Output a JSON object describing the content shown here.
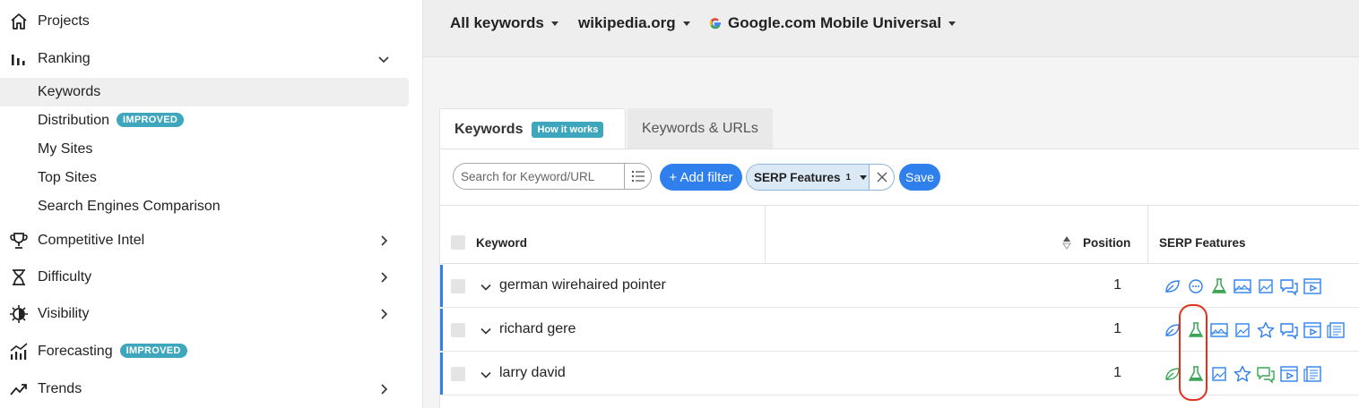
{
  "sidebar": {
    "items": [
      {
        "label": "Projects",
        "icon": "home-icon"
      },
      {
        "label": "Ranking",
        "icon": "bar-chart-icon",
        "expanded": true,
        "children": [
          {
            "label": "Keywords",
            "active": true
          },
          {
            "label": "Distribution",
            "badge": "IMPROVED"
          },
          {
            "label": "My Sites"
          },
          {
            "label": "Top Sites"
          },
          {
            "label": "Search Engines Comparison"
          }
        ]
      },
      {
        "label": "Competitive Intel",
        "icon": "trophy-icon"
      },
      {
        "label": "Difficulty",
        "icon": "hourglass-icon"
      },
      {
        "label": "Visibility",
        "icon": "visibility-gear-icon"
      },
      {
        "label": "Forecasting",
        "icon": "forecast-chart-icon",
        "badge": "IMPROVED"
      },
      {
        "label": "Trends",
        "icon": "trend-line-icon"
      }
    ]
  },
  "topbar": {
    "keywords_filter": "All keywords",
    "site": "wikipedia.org",
    "engine": "Google.com Mobile Universal"
  },
  "tabs": {
    "keywords": "Keywords",
    "how_it_works": "How it works",
    "keywords_urls": "Keywords & URLs"
  },
  "toolbar": {
    "search_placeholder": "Search for Keyword/URL",
    "add_filter": "+ Add filter",
    "serp_filter": "SERP Features",
    "serp_filter_count": "1",
    "save": "Save"
  },
  "table": {
    "headers": {
      "keyword": "Keyword",
      "position": "Position",
      "serp": "SERP Features"
    },
    "rows": [
      {
        "keyword": "german wirehaired pointer",
        "position": "1",
        "serp": [
          "leaf-icon",
          "chat-bubble-icon",
          "flask-icon",
          "image-pack-icon",
          "image-icon",
          "reviews-icon",
          "video-icon"
        ]
      },
      {
        "keyword": "richard gere",
        "position": "1",
        "serp": [
          "leaf-icon",
          "flask-icon",
          "image-pack-icon",
          "image-icon",
          "star-icon",
          "reviews-icon",
          "video-icon",
          "news-icon"
        ]
      },
      {
        "keyword": "larry david",
        "position": "1",
        "serp": [
          "leaf-icon",
          "flask-icon",
          "image-icon",
          "star-icon",
          "reviews-icon",
          "video-icon",
          "news-icon"
        ]
      }
    ]
  },
  "colors": {
    "accent": "#2f80ed",
    "badge": "#3fa7bd",
    "highlight": "#e0301e",
    "icon_blue": "#2f80ed",
    "icon_green": "#3aa655"
  }
}
